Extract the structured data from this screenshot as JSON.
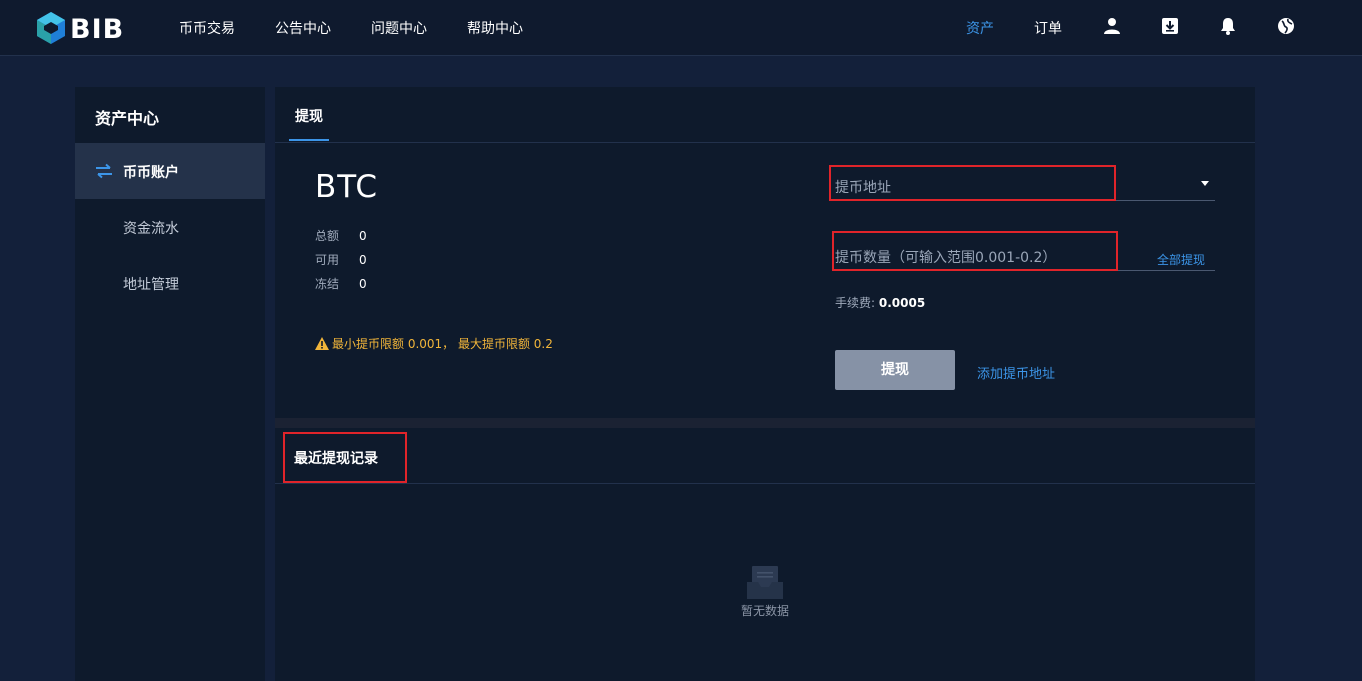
{
  "brand": {
    "name": "BIB"
  },
  "nav": {
    "items": [
      {
        "label": "币币交易"
      },
      {
        "label": "公告中心"
      },
      {
        "label": "问题中心"
      },
      {
        "label": "帮助中心"
      }
    ],
    "assets_label": "资产",
    "orders_label": "订单",
    "icons": [
      "user-icon",
      "download-icon",
      "bell-icon",
      "globe-icon"
    ]
  },
  "sidebar": {
    "title": "资产中心",
    "items": [
      {
        "label": "币币账户",
        "active": true,
        "icon": "exchange-arrows-icon"
      },
      {
        "label": "资金流水",
        "active": false
      },
      {
        "label": "地址管理",
        "active": false
      }
    ]
  },
  "main": {
    "tab_label": "提现",
    "coin": "BTC",
    "balances": [
      {
        "key": "总额",
        "value": "0"
      },
      {
        "key": "可用",
        "value": "0"
      },
      {
        "key": "冻结",
        "value": "0"
      }
    ],
    "warning": "最小提币限额 0.001， 最大提币限额 0.2",
    "address_placeholder": "提币地址",
    "amount_placeholder": "提币数量（可输入范围0.001-0.2）",
    "withdraw_all_label": "全部提现",
    "fee_label": "手续费:",
    "fee_value": "0.0005",
    "withdraw_button": "提现",
    "add_address_link": "添加提币地址",
    "records_title": "最近提现记录",
    "empty_text": "暂无数据"
  },
  "colors": {
    "accent": "#3c95e8",
    "warning": "#f1b53a",
    "highlight_box": "#e0242a",
    "button_disabled": "#8692a6"
  }
}
